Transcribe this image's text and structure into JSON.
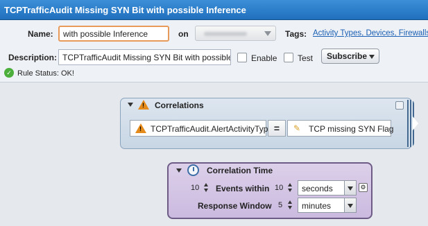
{
  "window": {
    "title": "TCPTrafficAudit Missing SYN Bit with possible Inference"
  },
  "form": {
    "name_label": "Name:",
    "name_value": "with possible Inference",
    "on_label": "on",
    "tags_label": "Tags:",
    "tags_value": "Activity Types, Devices, Firewalls, ...",
    "description_label": "Description:",
    "description_value": "TCPTrafficAudit Missing SYN Bit with possible Ur",
    "enable_label": "Enable",
    "test_label": "Test",
    "subscribe_label": "Subscribe",
    "rule_status": "Rule Status: OK!"
  },
  "correlations": {
    "title": "Correlations",
    "left_operand": "TCPTrafficAudit.AlertActivityType",
    "operator": "=",
    "right_operand": "TCP missing SYN Flag"
  },
  "correlation_time": {
    "title": "Correlation Time",
    "events_count": "10",
    "events_label": "Events within",
    "within_value": "10",
    "within_unit": "seconds",
    "response_label": "Response Window",
    "response_value": "5",
    "response_unit": "minutes"
  },
  "icons": {
    "status": "check-circle-icon",
    "warning": "warning-triangle-icon",
    "pencil": "pencil-icon",
    "clock": "clock-icon"
  }
}
